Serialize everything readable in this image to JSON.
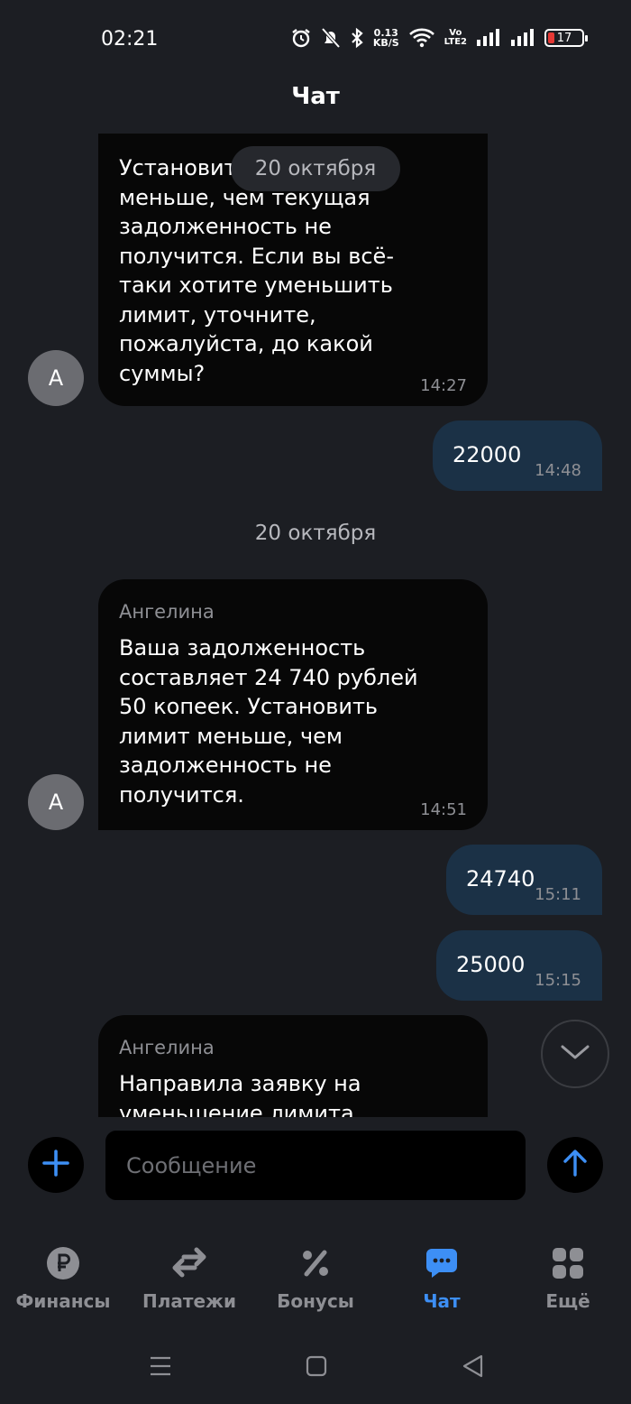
{
  "status_bar": {
    "time": "02:21",
    "net_speed_value": "0.13",
    "net_speed_unit": "KB/S",
    "volte_top": "Vo",
    "volte_bottom": "LTE2",
    "battery": "17",
    "icons": [
      "alarm-icon",
      "mute-icon",
      "bluetooth-icon",
      "wifi-icon",
      "signal-icon",
      "signal-icon",
      "battery-icon"
    ]
  },
  "header": {
    "title": "Чат"
  },
  "chat": {
    "messages": [
      {
        "direction": "in",
        "text": "Установить лимит меньше, чем текущая задолженность не получится. Если вы всё-таки хотите уменьшить лимит, уточните, пожалуйста, до какой суммы?",
        "lines": [
          "Установит",
          "меньше, чем текущая",
          "задолженность не",
          "получится. Если вы всё-",
          "таки хотите уменьшить",
          "лимит, уточните,",
          "пожалуйста, до какой",
          "суммы?"
        ],
        "time": "14:27",
        "avatar": "A"
      },
      {
        "direction": "out",
        "text": "22000",
        "time": "14:48"
      },
      {
        "direction": "in",
        "sender": "Ангелина",
        "lines": [
          "Ваша задолженность",
          "составляет 24 740 рублей",
          "50 копеек. Установить",
          "лимит меньше, чем",
          "задолженность не",
          "получится."
        ],
        "time": "14:51",
        "avatar": "A"
      },
      {
        "direction": "out",
        "text": "24740",
        "time": "15:11"
      },
      {
        "direction": "out",
        "text": "25000",
        "time": "15:15"
      },
      {
        "direction": "in",
        "sender": "Ангелина",
        "lines": [
          "Направила заявку на",
          "уменьшение лимита"
        ]
      }
    ],
    "sticky_date": "20 октября",
    "date_separator": "20 октября"
  },
  "composer": {
    "placeholder": "Сообщение"
  },
  "tabs": [
    {
      "label": "Финансы",
      "icon": "ruble-icon",
      "active": false
    },
    {
      "label": "Платежи",
      "icon": "transfer-icon",
      "active": false
    },
    {
      "label": "Бонусы",
      "icon": "percent-icon",
      "active": false
    },
    {
      "label": "Чат",
      "icon": "chat-icon",
      "active": true
    },
    {
      "label": "Ещё",
      "icon": "grid-icon",
      "active": false
    }
  ],
  "colors": {
    "background": "#1c1e23",
    "incoming_bubble": "#070707",
    "outgoing_bubble": "#1b3146",
    "accent": "#3d8ff5",
    "muted_text": "#8e8f94"
  }
}
